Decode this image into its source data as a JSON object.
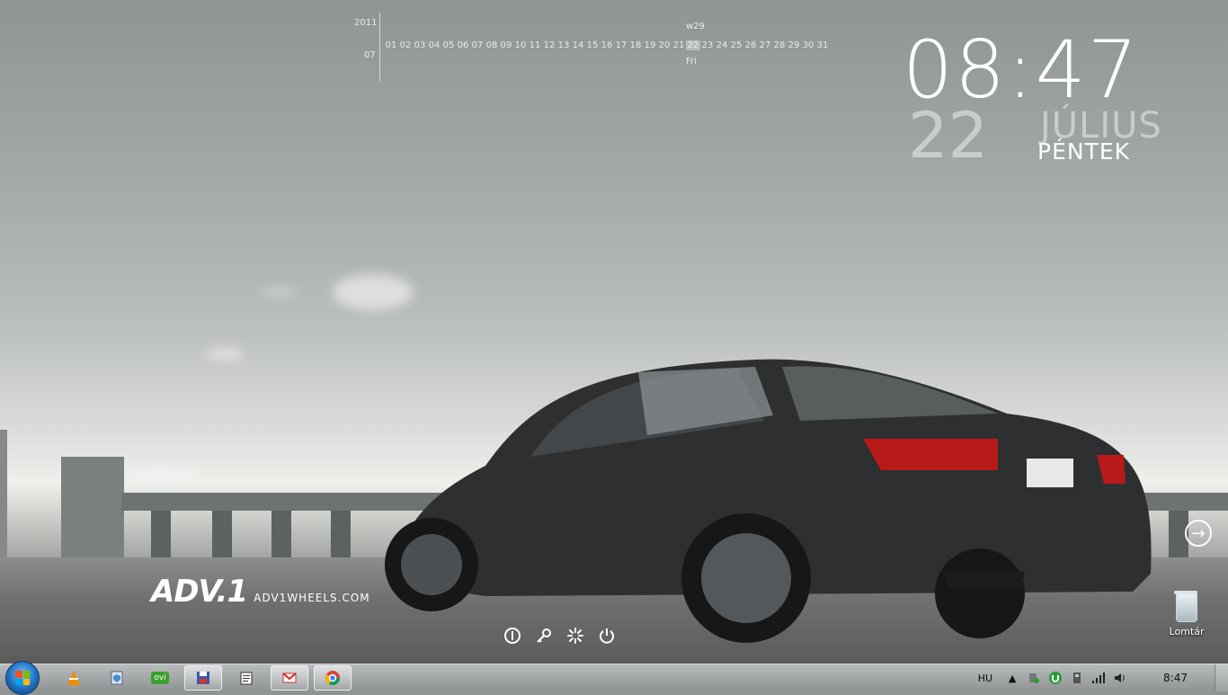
{
  "calendar": {
    "year": "2011",
    "month": "07",
    "week": "w29",
    "weekday": "Fri",
    "today": "22",
    "days": [
      "01",
      "02",
      "03",
      "04",
      "05",
      "06",
      "07",
      "08",
      "09",
      "10",
      "11",
      "12",
      "13",
      "14",
      "15",
      "16",
      "17",
      "18",
      "19",
      "20",
      "21",
      "22",
      "23",
      "24",
      "25",
      "26",
      "27",
      "28",
      "29",
      "30",
      "31"
    ]
  },
  "clock": {
    "time": "08:47",
    "day": "22",
    "month": "JÚLIUS",
    "weekday": "PÉNTEK"
  },
  "logo": {
    "brand": "ADV.1",
    "site": "ADV1WHEELS.COM"
  },
  "power_icons": [
    "info-icon",
    "key-icon",
    "settings-spinner-icon",
    "power-icon"
  ],
  "desktop": {
    "recycle_bin_label": "Lomtár"
  },
  "taskbar": {
    "items": [
      {
        "name": "vlc-icon",
        "active": false
      },
      {
        "name": "shield-doc-icon",
        "active": false
      },
      {
        "name": "ovi-icon",
        "active": false,
        "text": "ovi"
      },
      {
        "name": "save-floppy-icon",
        "active": true
      },
      {
        "name": "notepad-icon",
        "active": false
      },
      {
        "name": "gmail-icon",
        "active": true
      },
      {
        "name": "chrome-icon",
        "active": true
      }
    ],
    "tray": {
      "language": "HU",
      "time": "8:47"
    }
  },
  "colors": {
    "accent_white": "#ffffff",
    "taskbar": "#a3a7a8"
  }
}
